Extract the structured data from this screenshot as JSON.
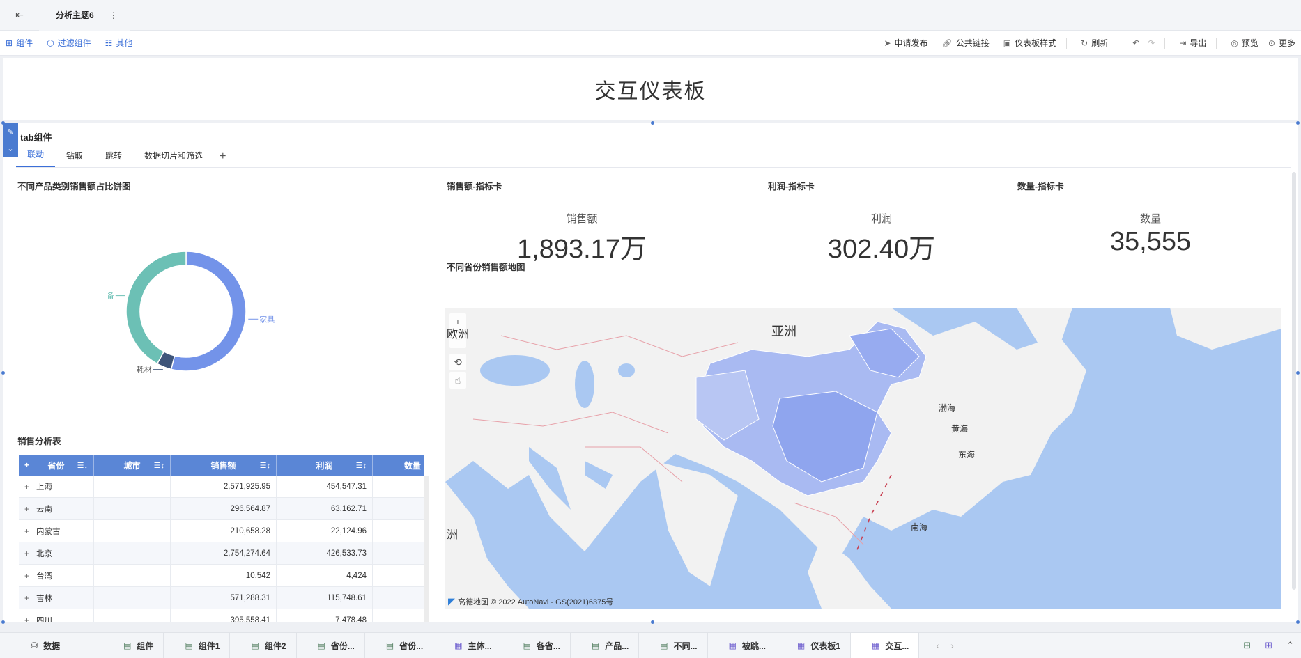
{
  "topbar": {
    "back_icon": "exit-icon",
    "tab_title": "分析主题6",
    "tab_menu": "⋮"
  },
  "toolbar": {
    "left": [
      {
        "icon": "component-icon",
        "label": "组件"
      },
      {
        "icon": "filter-component-icon",
        "label": "过滤组件"
      },
      {
        "icon": "other-icon",
        "label": "其他"
      }
    ],
    "right": [
      {
        "icon": "send-icon",
        "label": "申请发布"
      },
      {
        "icon": "link-icon",
        "label": "公共链接"
      },
      {
        "icon": "style-icon",
        "label": "仪表板样式"
      },
      {
        "icon": "refresh-icon",
        "label": "刷新"
      },
      {
        "icon": "export-icon",
        "label": "导出"
      },
      {
        "icon": "preview-icon",
        "label": "预览"
      },
      {
        "icon": "more-icon",
        "label": "更多"
      }
    ]
  },
  "dashboard": {
    "title": "交互仪表板"
  },
  "panel": {
    "title": "tab组件",
    "tabs": [
      "联动",
      "钻取",
      "跳转",
      "数据切片和筛选"
    ],
    "add_tab": "+"
  },
  "pie": {
    "title": "不同产品类别销售额占比饼图",
    "labels": {
      "furniture": "家具",
      "equipment": "设备",
      "consumables": "耗材"
    }
  },
  "kpis": [
    {
      "title": "销售额-指标卡",
      "label": "销售额",
      "value": "1,893.17万"
    },
    {
      "title": "利润-指标卡",
      "label": "利润",
      "value": "302.40万"
    },
    {
      "title": "数量-指标卡",
      "label": "数量",
      "value": "35,555"
    }
  ],
  "table": {
    "title": "销售分析表",
    "headers": [
      "省份",
      "城市",
      "销售额",
      "利润",
      "数量"
    ],
    "rows": [
      {
        "province": "上海",
        "sales": "2,571,925.95",
        "profit": "454,547.31"
      },
      {
        "province": "云南",
        "sales": "296,564.87",
        "profit": "63,162.71"
      },
      {
        "province": "内蒙古",
        "sales": "210,658.28",
        "profit": "22,124.96"
      },
      {
        "province": "北京",
        "sales": "2,754,274.64",
        "profit": "426,533.73"
      },
      {
        "province": "台湾",
        "sales": "10,542",
        "profit": "4,424"
      },
      {
        "province": "吉林",
        "sales": "571,288.31",
        "profit": "115,748.61"
      },
      {
        "province": "四川",
        "sales": "395,558.41",
        "profit": "7,478.48"
      }
    ]
  },
  "map": {
    "title": "不同省份销售额地图",
    "labels": {
      "asia": "亚洲",
      "europe_partial": "欧洲",
      "africa_partial": "洲",
      "bohai": "渤海",
      "yellow_sea": "黄海",
      "east_sea": "东海",
      "south_sea": "南海"
    },
    "attribution": "高德地图 © 2022 AutoNavi - GS(2021)6375号"
  },
  "chart_data": {
    "type": "pie",
    "title": "不同产品类别销售额占比饼图",
    "categories": [
      "家具",
      "耗材",
      "设备"
    ],
    "values": [
      54,
      4,
      42
    ],
    "colors": [
      "#7393e9",
      "#3e557a",
      "#6cc0b5"
    ]
  },
  "bottom_tabs": [
    {
      "icon": "database-icon",
      "label": "数据",
      "type": "data"
    },
    {
      "icon": "chart-icon",
      "label": "组件",
      "type": "chart"
    },
    {
      "icon": "chart-icon",
      "label": "组件1",
      "type": "chart"
    },
    {
      "icon": "chart-icon",
      "label": "组件2",
      "type": "chart"
    },
    {
      "icon": "chart-icon",
      "label": "省份...",
      "type": "chart"
    },
    {
      "icon": "chart-icon",
      "label": "省份...",
      "type": "chart"
    },
    {
      "icon": "dashboard-icon",
      "label": "主体...",
      "type": "dashboard"
    },
    {
      "icon": "chart-icon",
      "label": "各省...",
      "type": "chart"
    },
    {
      "icon": "chart-icon",
      "label": "产品...",
      "type": "chart"
    },
    {
      "icon": "chart-icon",
      "label": "不同...",
      "type": "chart"
    },
    {
      "icon": "dashboard-icon",
      "label": "被跳...",
      "type": "dashboard"
    },
    {
      "icon": "dashboard-icon",
      "label": "仪表板1",
      "type": "dashboard"
    },
    {
      "icon": "dashboard-icon",
      "label": "交互...",
      "type": "dashboard"
    }
  ]
}
